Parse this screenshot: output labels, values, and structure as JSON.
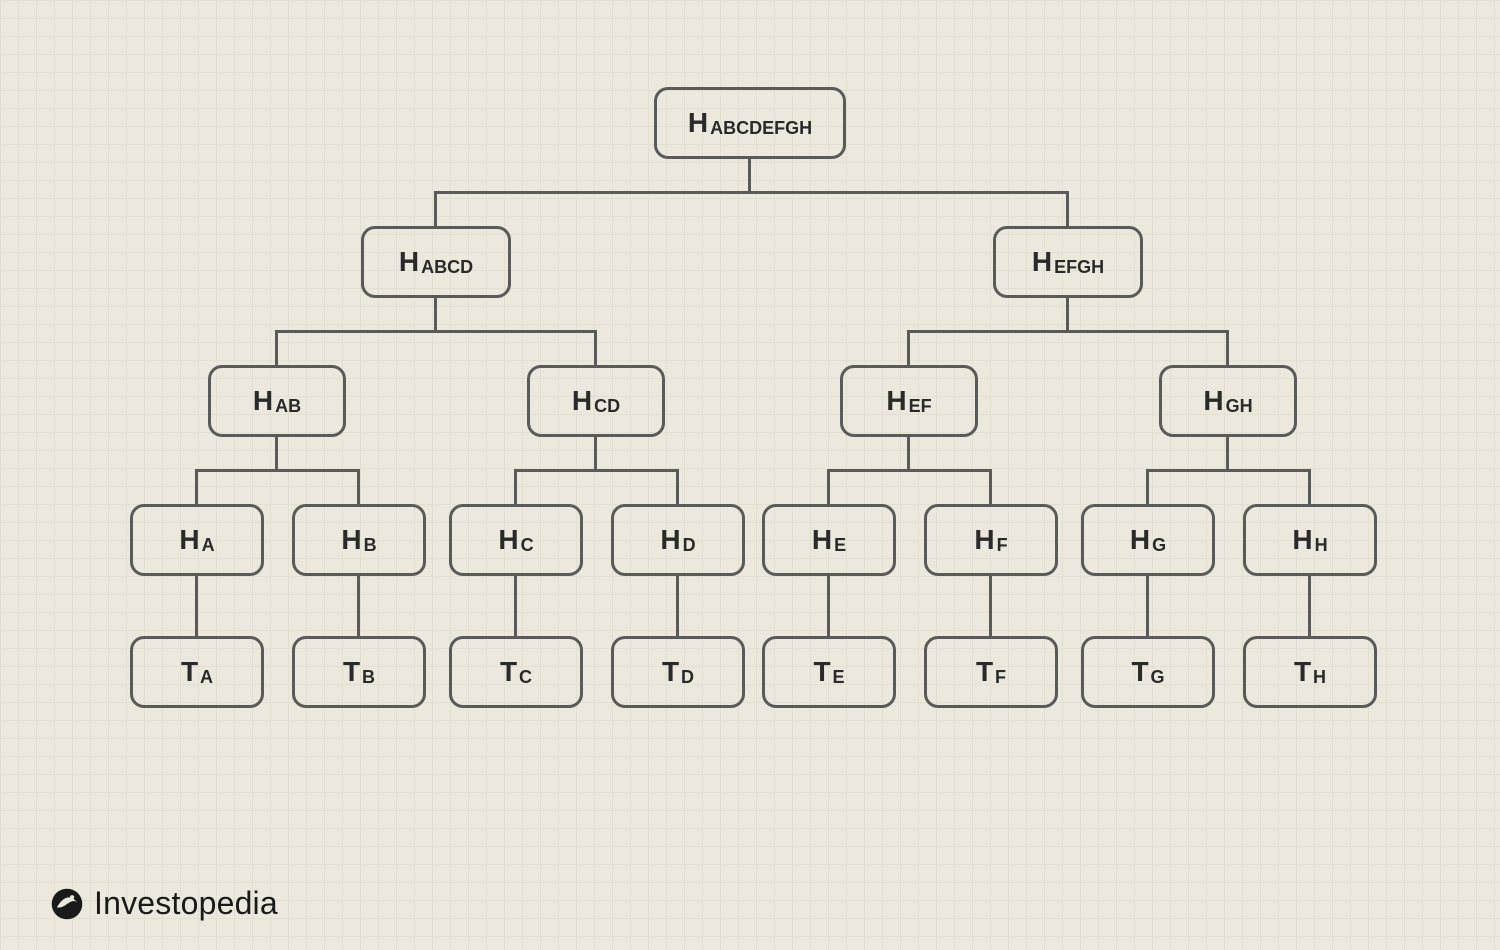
{
  "brand": "Investopedia",
  "nodes": {
    "l0": {
      "main": "H",
      "sub": "ABCDEFGH"
    },
    "l1a": {
      "main": "H",
      "sub": "ABCD"
    },
    "l1b": {
      "main": "H",
      "sub": "EFGH"
    },
    "l2a": {
      "main": "H",
      "sub": "AB"
    },
    "l2b": {
      "main": "H",
      "sub": "CD"
    },
    "l2c": {
      "main": "H",
      "sub": "EF"
    },
    "l2d": {
      "main": "H",
      "sub": "GH"
    },
    "l3a": {
      "main": "H",
      "sub": "A"
    },
    "l3b": {
      "main": "H",
      "sub": "B"
    },
    "l3c": {
      "main": "H",
      "sub": "C"
    },
    "l3d": {
      "main": "H",
      "sub": "D"
    },
    "l3e": {
      "main": "H",
      "sub": "E"
    },
    "l3f": {
      "main": "H",
      "sub": "F"
    },
    "l3g": {
      "main": "H",
      "sub": "G"
    },
    "l3h": {
      "main": "H",
      "sub": "H"
    },
    "l4a": {
      "main": "T",
      "sub": "A"
    },
    "l4b": {
      "main": "T",
      "sub": "B"
    },
    "l4c": {
      "main": "T",
      "sub": "C"
    },
    "l4d": {
      "main": "T",
      "sub": "D"
    },
    "l4e": {
      "main": "T",
      "sub": "E"
    },
    "l4f": {
      "main": "T",
      "sub": "F"
    },
    "l4g": {
      "main": "T",
      "sub": "G"
    },
    "l4h": {
      "main": "T",
      "sub": "H"
    }
  }
}
